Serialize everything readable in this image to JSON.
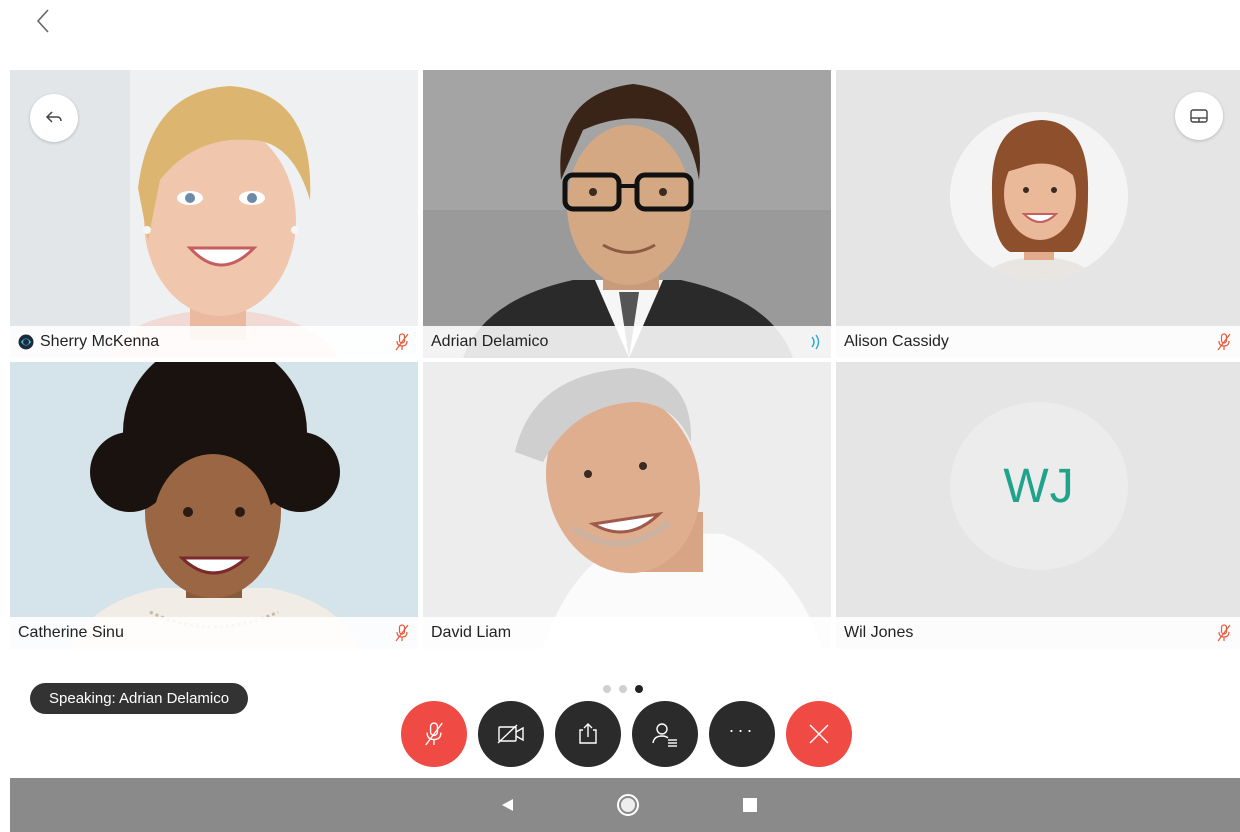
{
  "nav": {
    "back_icon": "chevron-left-icon"
  },
  "tiles": [
    {
      "name": "Sherry McKenna",
      "status_icon": "mic-muted-icon",
      "badge_icon": "webex-logo-icon"
    },
    {
      "name": "Adrian Delamico",
      "status_icon": "speaking-waves-icon",
      "active": true
    },
    {
      "name": "Alison Cassidy",
      "status_icon": "mic-muted-icon"
    },
    {
      "name": "Catherine Sinu",
      "status_icon": "mic-muted-icon"
    },
    {
      "name": "David Liam",
      "status_icon": "none"
    },
    {
      "name": "Wil Jones",
      "status_icon": "mic-muted-icon",
      "initials": "WJ"
    }
  ],
  "speaking_label": "Speaking: Adrian Delamico",
  "pagination": {
    "total": 3,
    "current": 3
  },
  "controls": [
    {
      "id": "mute",
      "icon": "mic-muted-icon",
      "color": "#f04a45"
    },
    {
      "id": "video",
      "icon": "video-off-icon",
      "color": "#2b2b2b"
    },
    {
      "id": "share",
      "icon": "share-icon",
      "color": "#2b2b2b"
    },
    {
      "id": "participants",
      "icon": "participants-icon",
      "color": "#2b2b2b"
    },
    {
      "id": "more",
      "label": "···",
      "color": "#2b2b2b"
    },
    {
      "id": "end",
      "icon": "close-icon",
      "color": "#f04a45"
    }
  ],
  "colors": {
    "accent": "#29a7d8",
    "end_call": "#f04a45",
    "initials": "#1fa38a",
    "muted": "#e8583a"
  }
}
